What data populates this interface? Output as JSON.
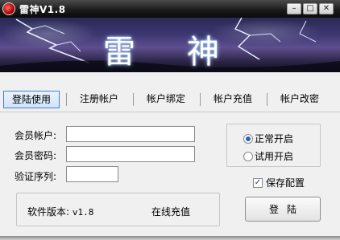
{
  "window": {
    "title": "雷神V1.8",
    "min_symbol": "–",
    "max_symbol": "□",
    "close_symbol": "✕"
  },
  "banner": {
    "char1": "雷",
    "char2": "神"
  },
  "tabs": [
    {
      "label": "登陆使用",
      "active": true
    },
    {
      "label": "注册帐户"
    },
    {
      "label": "帐户绑定"
    },
    {
      "label": "帐户充值"
    },
    {
      "label": "帐户改密"
    }
  ],
  "form": {
    "member_account_label": "会员帐户:",
    "member_password_label": "会员密码:",
    "verify_code_label": "验证序列:",
    "member_account_value": "",
    "member_password_value": "",
    "verify_code_value": ""
  },
  "mode": {
    "normal_label": "正常开启",
    "trial_label": "试用开启",
    "selected": "normal"
  },
  "save_config": {
    "label": "保存配置",
    "checked": true,
    "check_mark": "✓"
  },
  "version": {
    "label": "软件版本:",
    "value": "v1.8",
    "recharge_link": "在线充值"
  },
  "login_button": "登陆",
  "colors": {
    "active_tab_border": "#4a7cc7",
    "radio_dot": "#2d5fb5"
  }
}
